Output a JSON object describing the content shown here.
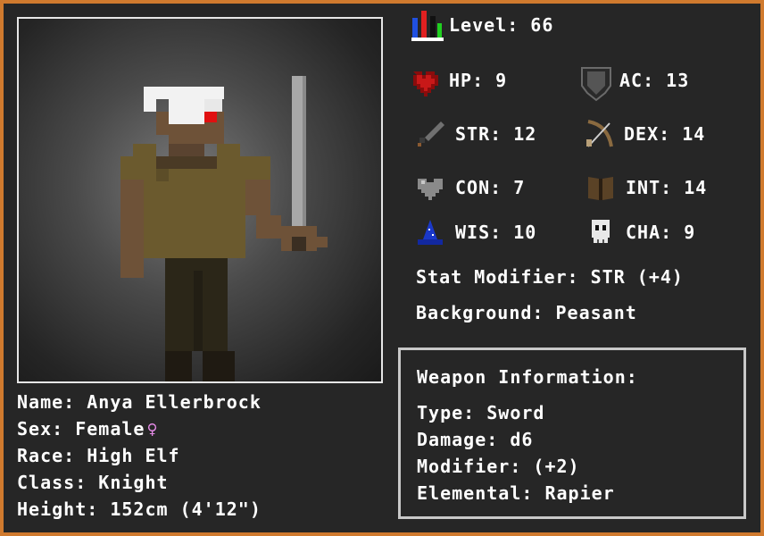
{
  "character": {
    "name_line": "Name: Anya Ellerbrock",
    "sex_line": "Sex: Female",
    "sex_symbol": "♀",
    "race_line": "Race: High Elf",
    "class_line": "Class: Knight",
    "height_line": "Height: 152cm (4'12\")"
  },
  "stats": {
    "level": "Level: 66",
    "hp": "HP: 9",
    "ac": "AC: 13",
    "str": "STR: 12",
    "dex": "DEX: 14",
    "con": "CON: 7",
    "int": "INT: 14",
    "wis": "WIS: 10",
    "cha": "CHA: 9",
    "modifier": "Stat Modifier: STR (+4)",
    "background": "Background: Peasant"
  },
  "weapon": {
    "header": "Weapon Information:",
    "type": "Type: Sword",
    "damage": "Damage: d6",
    "modifier": "Modifier: (+2)",
    "elemental": "Elemental: Rapier"
  },
  "icons": {
    "level": "level-bars-icon",
    "hp": "heart-icon",
    "ac": "shield-icon",
    "str": "sword-icon",
    "dex": "bow-icon",
    "con": "grey-heart-icon",
    "int": "book-icon",
    "wis": "wizard-hat-icon",
    "cha": "skull-icon"
  },
  "colors": {
    "border": "#d07a2e",
    "panel": "#262626",
    "text": "#ffffff",
    "female": "#e48ae6"
  }
}
